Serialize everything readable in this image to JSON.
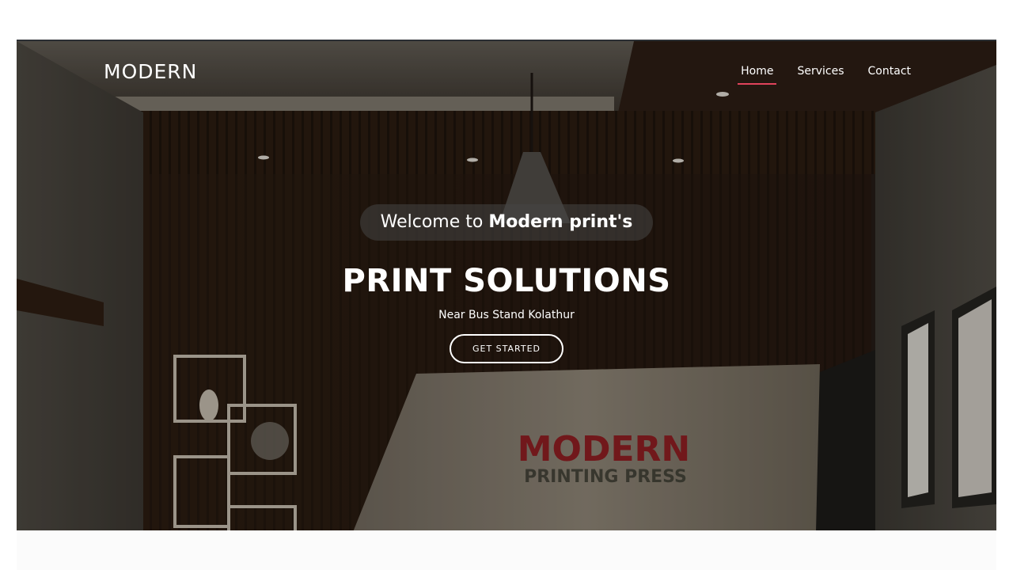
{
  "header": {
    "logo": "MODERN",
    "nav": [
      {
        "label": "Home",
        "active": true
      },
      {
        "label": "Services",
        "active": false
      },
      {
        "label": "Contact",
        "active": false
      }
    ],
    "accent_color": "#e0435b"
  },
  "hero": {
    "welcome_prefix": "Welcome to",
    "welcome_brand": "Modern print's",
    "headline": "PRINT SOLUTIONS",
    "subline": "Near Bus Stand Kolathur",
    "cta_label": "GET STARTED",
    "sign_title": "MODERN",
    "sign_subtitle": "PRINTING PRESS"
  }
}
